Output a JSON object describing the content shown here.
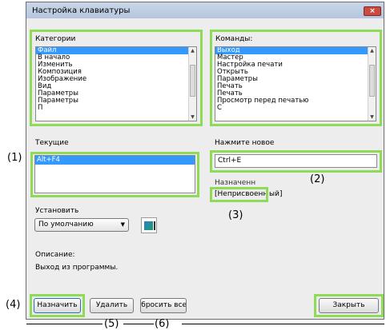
{
  "window": {
    "title": "Настройка клавиатуры",
    "close_glyph": "×"
  },
  "categories": {
    "label": "Категории",
    "items": [
      "Файл",
      "В начало",
      "Изменить",
      "Композиция",
      "Изображение",
      "Вид",
      "Параметры",
      "Параметры",
      "П"
    ],
    "selected_index": 0
  },
  "commands": {
    "label": "Команды:",
    "items": [
      "Выход",
      "Мастер",
      "Настройка печати",
      "Открыть",
      "Параметры",
      "Печать",
      "Печать",
      "Просмотр перед печатью",
      "С"
    ],
    "selected_index": 0
  },
  "current": {
    "label": "Текущие",
    "items": [
      "Alt+F4"
    ]
  },
  "new_shortcut": {
    "label": "Нажмите новое",
    "value": "Ctrl+E"
  },
  "assigned": {
    "label": "Назначенн",
    "value": "[Неприсвоенн",
    "value_tail": "ый]"
  },
  "set_to": {
    "label": "Установить",
    "value": "По умолчанию"
  },
  "description": {
    "label": "Описание:",
    "text": "Выход из программы."
  },
  "buttons": {
    "assign": "Назначить",
    "remove": "Удалить",
    "reset_all": "Сбросить все",
    "close": "Закрыть"
  },
  "callouts": {
    "c1": "(1)",
    "c2": "(2)",
    "c3": "(3)",
    "c4": "(4)",
    "c5": "(5)",
    "c6": "(6)"
  },
  "colors": {
    "highlight": "#8fdb58",
    "selection": "#3399ff",
    "close_button": "#c94b41"
  }
}
